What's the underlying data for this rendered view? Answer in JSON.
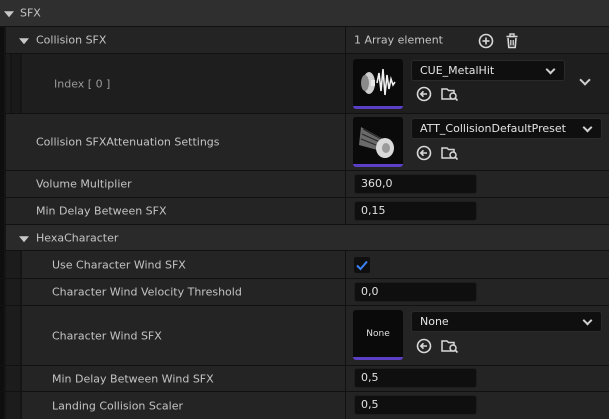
{
  "section": {
    "title": "SFX"
  },
  "collision_sfx": {
    "label": "Collision SFX",
    "count": "1 Array element",
    "index_label": "Index [ 0 ]",
    "asset": "CUE_MetalHit"
  },
  "attenuation": {
    "label": "Collision SFXAttenuation Settings",
    "asset": "ATT_CollisionDefaultPreset"
  },
  "volume": {
    "label": "Volume Multiplier",
    "value": "360,0"
  },
  "min_delay": {
    "label": "Min Delay Between SFX",
    "value": "0,15"
  },
  "hexa": {
    "title": "HexaCharacter",
    "use_wind_label": "Use Character Wind SFX",
    "use_wind_checked": true,
    "wind_threshold_label": "Character Wind Velocity Threshold",
    "wind_threshold_value": "0,0",
    "wind_sfx_label": "Character Wind SFX",
    "wind_sfx_thumb": "None",
    "wind_sfx_asset": "None",
    "min_delay_wind_label": "Min Delay Between Wind SFX",
    "min_delay_wind_value": "0,5",
    "landing_label": "Landing Collision Scaler",
    "landing_value": "0,5"
  },
  "colors": {
    "accent": "#5b3fc4",
    "checkbox": "#3b82f6"
  },
  "icons": [
    "add-icon",
    "trash-icon",
    "browse-arrow-icon",
    "find-in-browser-icon",
    "chevron-down-icon",
    "checkmark-icon"
  ]
}
